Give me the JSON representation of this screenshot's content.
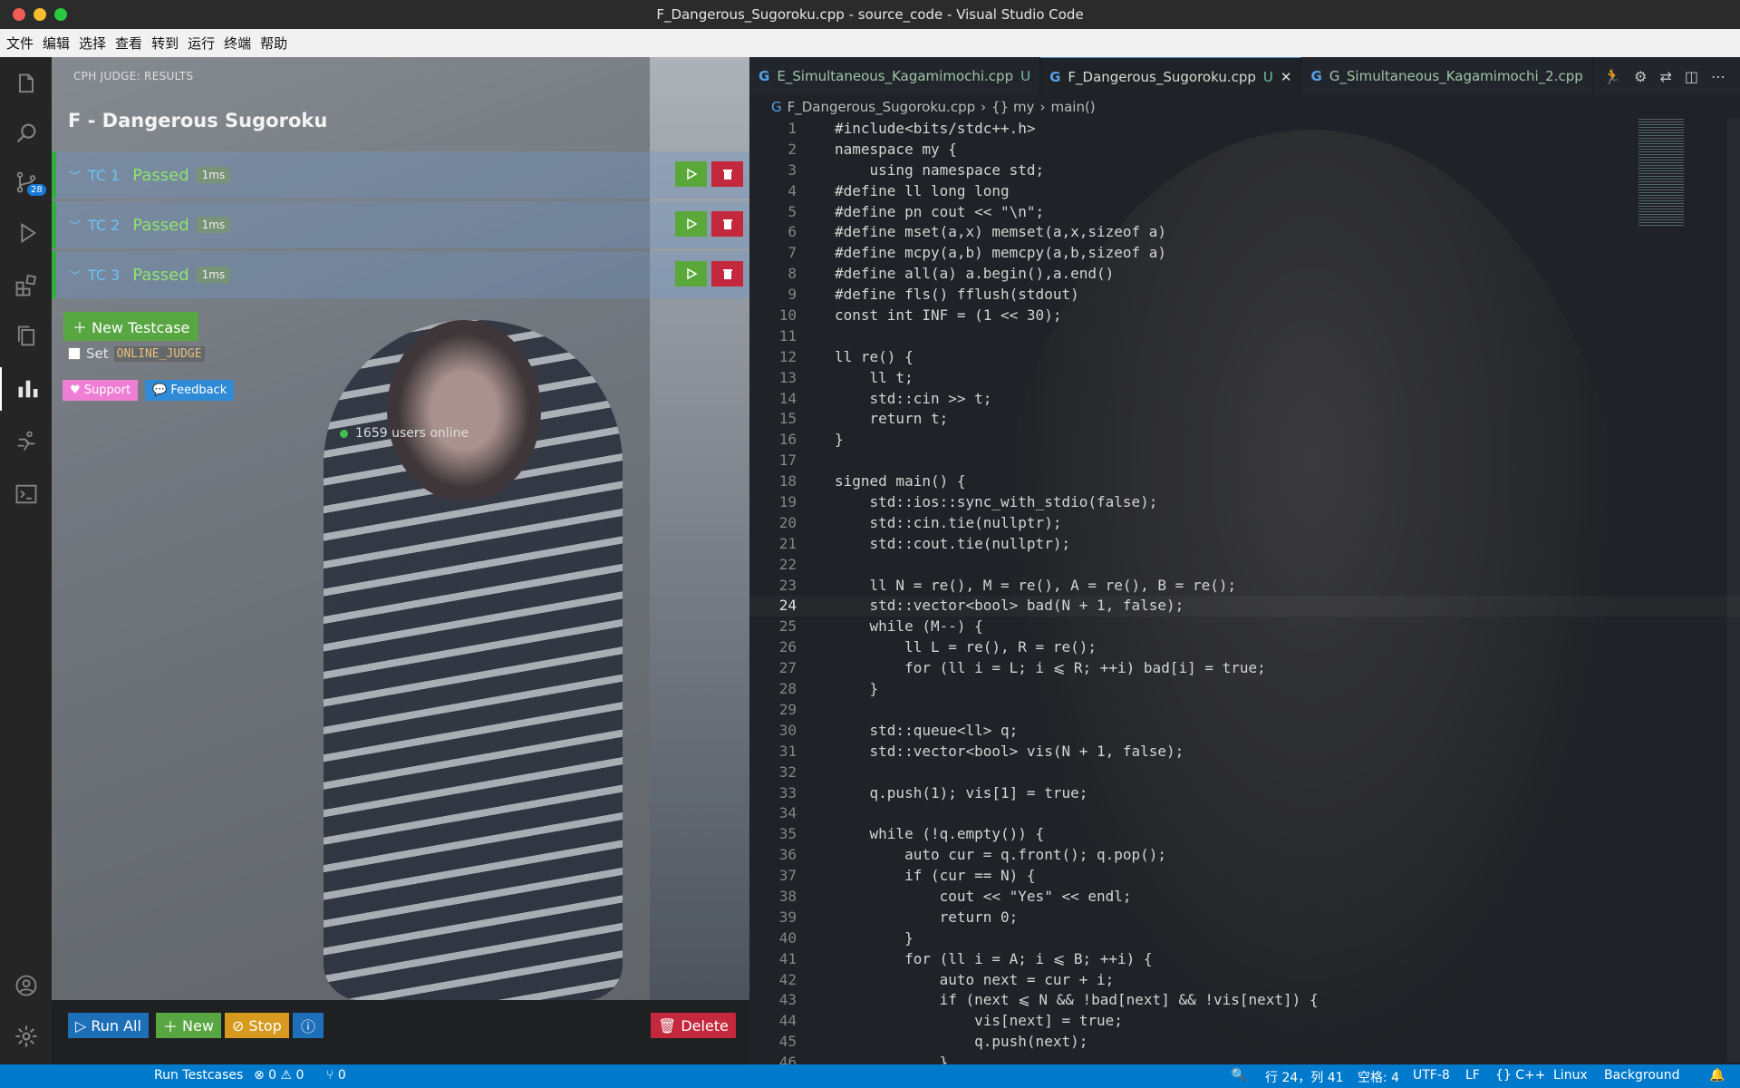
{
  "window": {
    "title": "F_Dangerous_Sugoroku.cpp - source_code - Visual Studio Code"
  },
  "menu": [
    "文件",
    "编辑",
    "选择",
    "查看",
    "转到",
    "运行",
    "终端",
    "帮助"
  ],
  "activity": {
    "scm_badge": "28"
  },
  "cph": {
    "header": "CPH JUDGE: RESULTS",
    "problem_title": "F - Dangerous Sugoroku",
    "testcases": [
      {
        "id": "TC 1",
        "status": "Passed",
        "time": "1ms"
      },
      {
        "id": "TC 2",
        "status": "Passed",
        "time": "1ms"
      },
      {
        "id": "TC 3",
        "status": "Passed",
        "time": "1ms"
      }
    ],
    "new_testcase": "New Testcase",
    "set_label": "Set",
    "online_judge": "ONLINE_JUDGE",
    "support": "Support",
    "feedback": "Feedback",
    "online_users": "1659 users online",
    "run_all": "Run All",
    "new": "New",
    "stop": "Stop",
    "delete": "Delete"
  },
  "tabs": [
    {
      "name": "E_Simultaneous_Kagamimochi.cpp",
      "flag": "U"
    },
    {
      "name": "F_Dangerous_Sugoroku.cpp",
      "flag": "U"
    },
    {
      "name": "G_Simultaneous_Kagamimochi_2.cpp",
      "flag": ""
    }
  ],
  "breadcrumb": {
    "file": "F_Dangerous_Sugoroku.cpp",
    "ns": "{} my",
    "fn": "main()"
  },
  "code": [
    "#include<bits/stdc++.h>",
    "namespace my {",
    "    using namespace std;",
    "#define ll long long",
    "#define pn cout << \"\\n\";",
    "#define mset(a,x) memset(a,x,sizeof a)",
    "#define mcpy(a,b) memcpy(a,b,sizeof a)",
    "#define all(a) a.begin(),a.end()",
    "#define fls() fflush(stdout)",
    "const int INF = (1 << 30);",
    "",
    "ll re() {",
    "    ll t;",
    "    std::cin >> t;",
    "    return t;",
    "}",
    "",
    "signed main() {",
    "    std::ios::sync_with_stdio(false);",
    "    std::cin.tie(nullptr);",
    "    std::cout.tie(nullptr);",
    "",
    "    ll N = re(), M = re(), A = re(), B = re();",
    "    std::vector<bool> bad(N + 1, false);",
    "    while (M--) {",
    "        ll L = re(), R = re();",
    "        for (ll i = L; i ⩽ R; ++i) bad[i] = true;",
    "    }",
    "",
    "    std::queue<ll> q;",
    "    std::vector<bool> vis(N + 1, false);",
    "",
    "    q.push(1); vis[1] = true;",
    "",
    "    while (!q.empty()) {",
    "        auto cur = q.front(); q.pop();",
    "        if (cur == N) {",
    "            cout << \"Yes\" << endl;",
    "            return 0;",
    "        }",
    "        for (ll i = A; i ⩽ B; ++i) {",
    "            auto next = cur + i;",
    "            if (next ⩽ N && !bad[next] && !vis[next]) {",
    "                vis[next] = true;",
    "                q.push(next);",
    "            }"
  ],
  "current_line": 24,
  "status": {
    "run": "Run Testcases",
    "problems": "⊗ 0 ⚠ 0",
    "ports": "⑂ 0",
    "pos": "行 24，列 41",
    "spaces": "空格: 4",
    "encoding": "UTF-8",
    "eol": "LF",
    "lang": "{} C++",
    "os": "Linux",
    "bg": "Background"
  }
}
